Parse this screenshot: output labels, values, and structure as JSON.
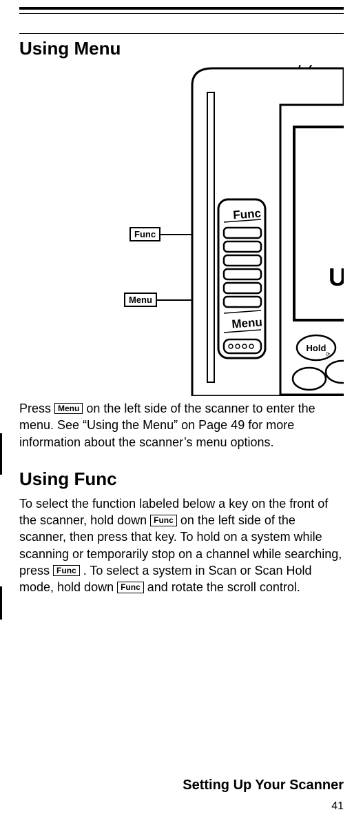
{
  "page": {
    "heading1": "Using Menu",
    "heading2": "Using Func",
    "footer_section": "Setting Up Your Scanner",
    "page_number": "41"
  },
  "callouts": {
    "func": "Func",
    "menu": "Menu"
  },
  "device_labels": {
    "func": "Func",
    "menu": "Menu",
    "hold": "Hold"
  },
  "keys": {
    "menu": "Menu",
    "func": "Func"
  },
  "paragraphs": {
    "p1a": "Press ",
    "p1b": " on the left side of the scanner to enter the menu. See “Using the Menu” on Page 49 for more information about the scanner’s menu options.",
    "p2a": "To select the function labeled below a key on the front of the scanner, hold down ",
    "p2b": " on the left side of the scanner, then press that key. To hold on a system while scanning or temporarily stop on a channel while searching, press ",
    "p2c": ". To select a system in Scan or Scan Hold mode, hold down ",
    "p2d": " and rotate the scroll control."
  }
}
